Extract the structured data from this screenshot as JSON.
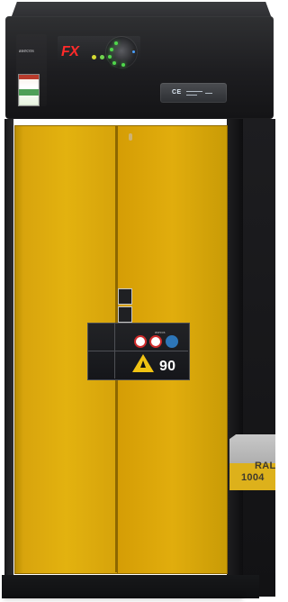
{
  "product": {
    "brand_top": "asecos",
    "series_top": "FX",
    "label_brand": "asecos",
    "rating": "90",
    "ral_line_1": "RAL",
    "ral_line_2": "1004"
  },
  "icons": {
    "panel_screen": "display-screen",
    "dial": "control-dial",
    "ce_mark": "ce-mark",
    "warning": "flammable-warning-icon",
    "safety_1": "no-fire-icon",
    "safety_2": "no-smoking-icon",
    "safety_3": "instruction-icon"
  },
  "colors": {
    "cabinet_dark": "#1d1d20",
    "door_yellow": "#e3b20f",
    "accent_red": "#ff2a2a",
    "led_green": "#4fd74b",
    "ral_yellow": "#ddb11b"
  }
}
